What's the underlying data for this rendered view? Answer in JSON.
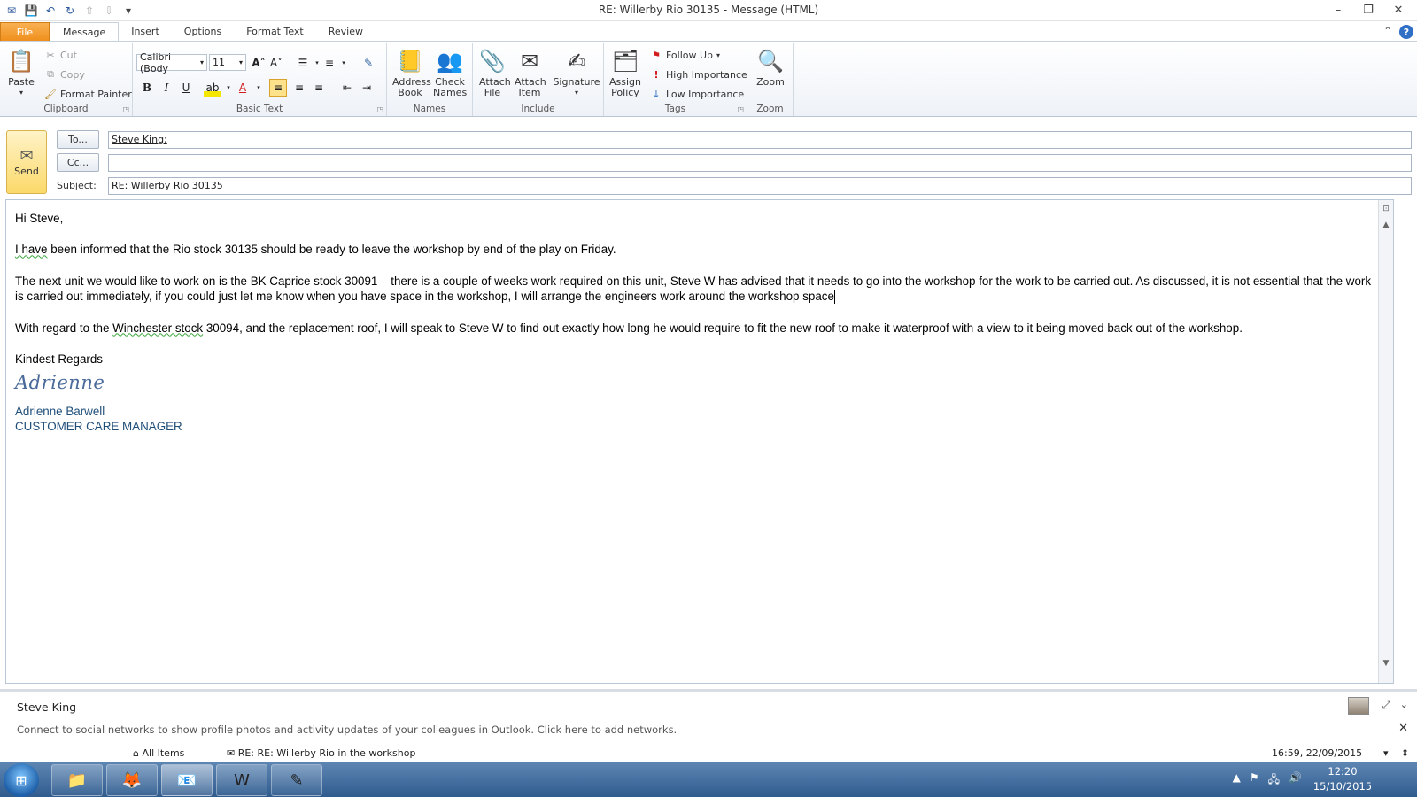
{
  "window": {
    "title": "RE: Willerby Rio 30135  -  Message (HTML)"
  },
  "tabs": [
    {
      "label": "File"
    },
    {
      "label": "Message"
    },
    {
      "label": "Insert"
    },
    {
      "label": "Options"
    },
    {
      "label": "Format Text"
    },
    {
      "label": "Review"
    }
  ],
  "ribbon": {
    "clipboard": {
      "label": "Clipboard",
      "paste": "Paste",
      "cut": "Cut",
      "copy": "Copy",
      "format_painter": "Format Painter"
    },
    "basic_text": {
      "label": "Basic Text",
      "font": "Calibri (Body",
      "size": "11"
    },
    "names": {
      "label": "Names",
      "address_book": "Address Book",
      "check_names": "Check Names"
    },
    "include": {
      "label": "Include",
      "attach_file": "Attach File",
      "attach_item": "Attach Item",
      "signature": "Signature"
    },
    "tags": {
      "label": "Tags",
      "assign_policy": "Assign Policy",
      "follow_up": "Follow Up",
      "high_importance": "High Importance",
      "low_importance": "Low Importance"
    },
    "zoom": {
      "label": "Zoom",
      "zoom": "Zoom"
    }
  },
  "header": {
    "send": "Send",
    "to_button": "To...",
    "cc_button": "Cc...",
    "subject_label": "Subject:",
    "to_value": "Steve King;",
    "cc_value": "",
    "subject_value": "RE: Willerby Rio 30135"
  },
  "body": {
    "greeting": "Hi Steve,",
    "p1_lead": "I  have",
    "p1_rest": " been informed that the Rio stock 30135 should be ready to leave the workshop by end of the play on Friday.",
    "p2": "The next unit we would like to work on is the BK Caprice  stock 30091 – there is a couple of weeks work required on this unit, Steve W has advised that it needs to go into the workshop for the work to be carried out.  As discussed, it is not essential that the work is carried out immediately, if you could just let me know when you have space in the workshop, I will arrange the engineers work around the workshop space",
    "p3_lead": "With regard to the ",
    "p3_flag": "Winchester  stock",
    "p3_rest": " 30094, and the replacement roof, I will speak to Steve W to find out exactly how long he would require to fit the new roof to make it waterproof with a view to it being moved back out of the workshop.",
    "closing": "Kindest Regards",
    "signature_script": "Adrienne",
    "signature_name": "Adrienne Barwell",
    "signature_title": "CUSTOMER CARE MANAGER"
  },
  "people_pane": {
    "name": "Steve King",
    "message": "Connect to social networks to show profile photos and activity updates of your colleagues in Outlook. Click here to add networks.",
    "all_items": "All Items",
    "item_subject": "RE: RE: Willerby Rio in the workshop",
    "item_date": "16:59, 22/09/2015"
  },
  "taskbar": {
    "time": "12:20",
    "date": "15/10/2015"
  }
}
